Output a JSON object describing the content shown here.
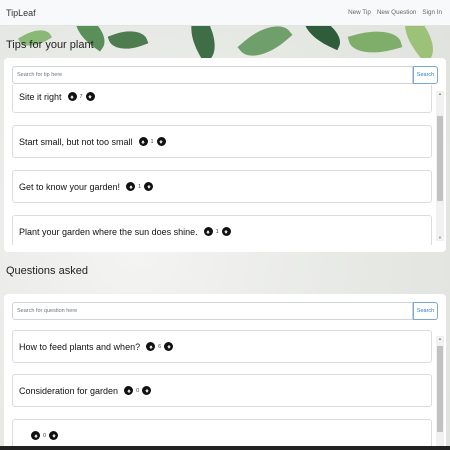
{
  "navbar": {
    "brand": "TipLeaf",
    "links": [
      "New Tip",
      "New Question",
      "Sign In"
    ]
  },
  "tips": {
    "title": "Tips for your plant",
    "search_placeholder": "Search for tip here",
    "search_button": "Search",
    "items": [
      {
        "title": "Site it right",
        "votes": "7"
      },
      {
        "title": "Start small, but not too small",
        "votes": "1"
      },
      {
        "title": "Get to know your garden!",
        "votes": "1"
      },
      {
        "title": "Plant your garden where the sun does shine.",
        "votes": "1"
      }
    ]
  },
  "questions": {
    "title": "Questions asked",
    "search_placeholder": "Search for question here",
    "search_button": "Search",
    "items": [
      {
        "title": "How to feed plants and when?",
        "votes": "6"
      },
      {
        "title": "Consideration for garden",
        "votes": "0"
      },
      {
        "title": "",
        "votes": "0"
      }
    ]
  },
  "colors": {
    "accent": "#2f7ad6",
    "vote_button": "#111111"
  },
  "icons": {
    "upvote": "arrow-up-icon",
    "downvote": "arrow-down-icon"
  }
}
